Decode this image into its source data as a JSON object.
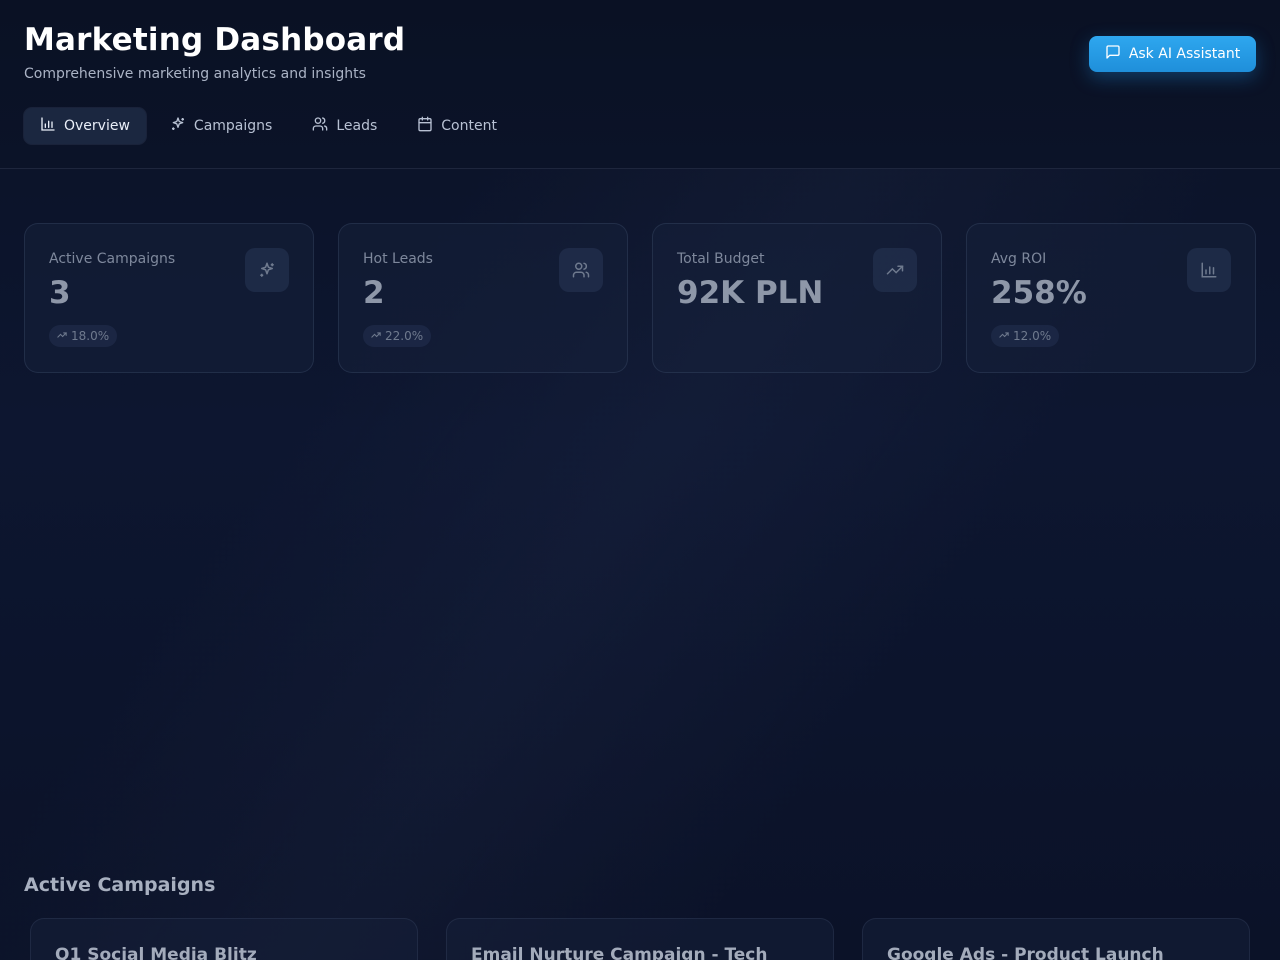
{
  "header": {
    "title": "Marketing Dashboard",
    "subtitle": "Comprehensive marketing analytics and insights",
    "ai_button_label": "Ask AI Assistant"
  },
  "tabs": [
    {
      "label": "Overview",
      "icon": "bar-chart-icon",
      "active": true
    },
    {
      "label": "Campaigns",
      "icon": "sparkles-icon",
      "active": false
    },
    {
      "label": "Leads",
      "icon": "users-icon",
      "active": false
    },
    {
      "label": "Content",
      "icon": "calendar-icon",
      "active": false
    }
  ],
  "stats": [
    {
      "label": "Active Campaigns",
      "value": "3",
      "change": "18.0%",
      "icon": "sparkles-icon"
    },
    {
      "label": "Hot Leads",
      "value": "2",
      "change": "22.0%",
      "icon": "users-icon"
    },
    {
      "label": "Total Budget",
      "value": "92K PLN",
      "change": "",
      "icon": "trending-up-icon"
    },
    {
      "label": "Avg ROI",
      "value": "258%",
      "change": "12.0%",
      "icon": "bar-chart-icon"
    }
  ],
  "active_campaigns": {
    "title": "Active Campaigns",
    "items": [
      {
        "name": "Q1 Social Media Blitz"
      },
      {
        "name": "Email Nurture Campaign - Tech"
      },
      {
        "name": "Google Ads - Product Launch"
      }
    ]
  },
  "colors": {
    "accent": "#2ea7ef",
    "background": "#0d1630"
  }
}
